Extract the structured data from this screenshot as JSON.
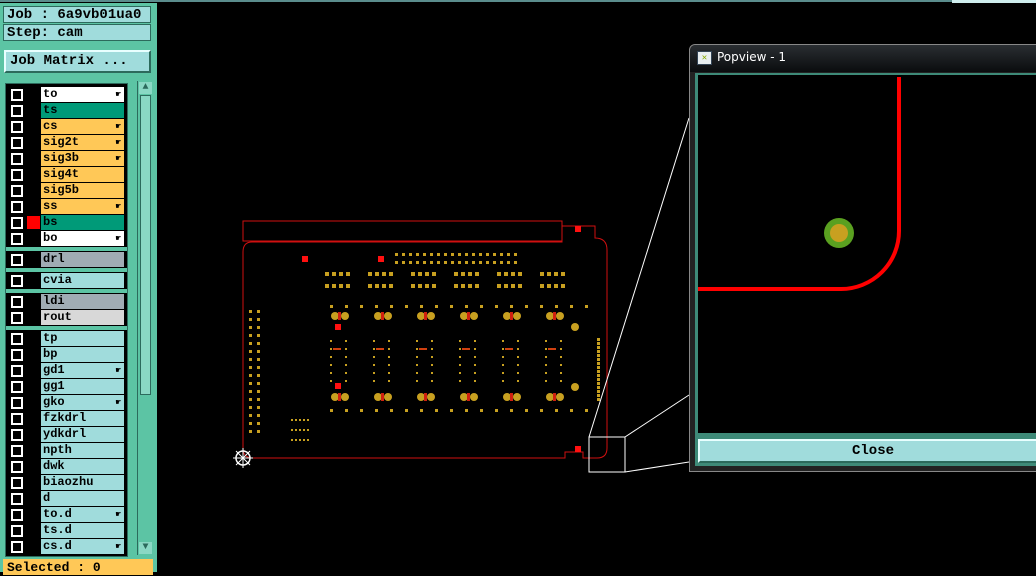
{
  "panel": {
    "job_label": "Job : 6a9vb01ua0",
    "step_label": "Step: cam",
    "job_matrix_button": "Job Matrix ...",
    "selected_label": "Selected : 0"
  },
  "layers": [
    {
      "name": "to",
      "color": "#ffffff",
      "hand": true
    },
    {
      "name": "ts",
      "color": "#009a78",
      "hand": false
    },
    {
      "name": "cs",
      "color": "#ffc857",
      "hand": true
    },
    {
      "name": "sig2t",
      "color": "#ffc857",
      "hand": true
    },
    {
      "name": "sig3b",
      "color": "#ffc857",
      "hand": true
    },
    {
      "name": "sig4t",
      "color": "#ffc857",
      "hand": false
    },
    {
      "name": "sig5b",
      "color": "#ffc857",
      "hand": false
    },
    {
      "name": "ss",
      "color": "#ffc857",
      "hand": true
    },
    {
      "name": "bs",
      "color": "#009a78",
      "hand": false,
      "active": true
    },
    {
      "name": "bo",
      "color": "#ffffff",
      "hand": true
    },
    {
      "name": "drl",
      "color": "#a0acb4",
      "hand": false
    },
    {
      "name": "cvia",
      "color": "#a0dcdc",
      "hand": false
    },
    {
      "name": "ldi",
      "color": "#a0acb4",
      "hand": false
    },
    {
      "name": "rout",
      "color": "#d8d8d8",
      "hand": false
    },
    {
      "name": "tp",
      "color": "#a0dcdc",
      "hand": false
    },
    {
      "name": "bp",
      "color": "#a0dcdc",
      "hand": false
    },
    {
      "name": "gd1",
      "color": "#a0dcdc",
      "hand": true
    },
    {
      "name": "gg1",
      "color": "#a0dcdc",
      "hand": false
    },
    {
      "name": "gko",
      "color": "#a0dcdc",
      "hand": true
    },
    {
      "name": "fzkdrl",
      "color": "#a0dcdc",
      "hand": false
    },
    {
      "name": "ydkdrl",
      "color": "#a0dcdc",
      "hand": false
    },
    {
      "name": "npth",
      "color": "#a0dcdc",
      "hand": false
    },
    {
      "name": "dwk",
      "color": "#a0dcdc",
      "hand": false
    },
    {
      "name": "biaozhu",
      "color": "#a0dcdc",
      "hand": false
    },
    {
      "name": "d",
      "color": "#a0dcdc",
      "hand": false
    },
    {
      "name": "to.d",
      "color": "#a0dcdc",
      "hand": true
    },
    {
      "name": "ts.d",
      "color": "#a0dcdc",
      "hand": false
    },
    {
      "name": "cs.d",
      "color": "#a0dcdc",
      "hand": true
    }
  ],
  "popview": {
    "title": "Popview - 1",
    "close_button": "Close"
  },
  "colors": {
    "outline": "#d01010",
    "pad": "#c8a020",
    "trace": "#ff0000",
    "pad_ring": "#5aa020"
  }
}
